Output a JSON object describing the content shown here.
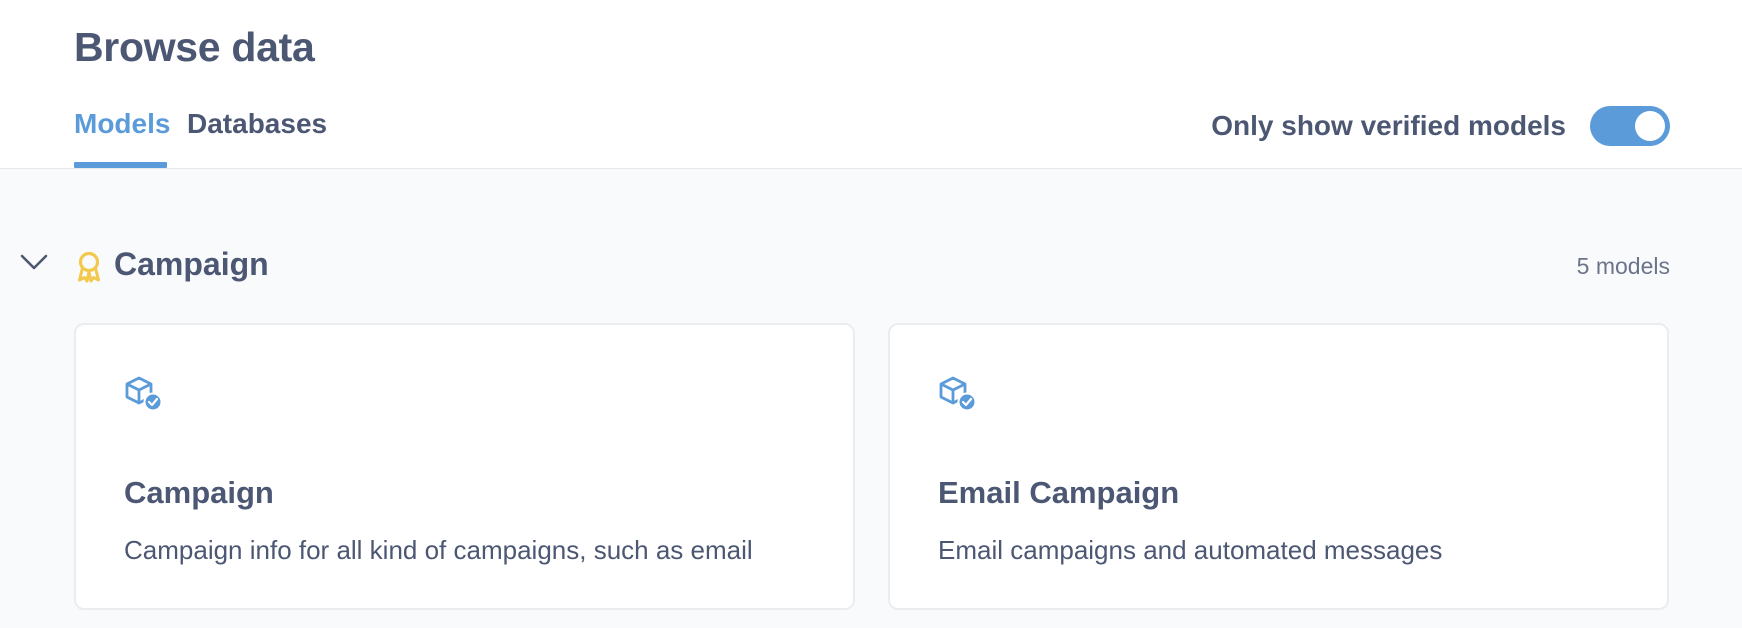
{
  "header": {
    "title": "Browse data",
    "tabs": [
      {
        "label": "Models",
        "active": true
      },
      {
        "label": "Databases",
        "active": false
      }
    ],
    "verified_toggle": {
      "label": "Only show verified models",
      "on": true
    }
  },
  "section": {
    "title": "Campaign",
    "count": "5 models",
    "expanded": true,
    "icon": "verified-badge-icon"
  },
  "cards": [
    {
      "icon": "verified-model-icon",
      "title": "Campaign",
      "description": "Campaign info for all kind of campaigns, such as email"
    },
    {
      "icon": "verified-model-icon",
      "title": "Email Campaign",
      "description": "Email campaigns and automated messages"
    }
  ],
  "colors": {
    "accent": "#5b9bd9",
    "text": "#4c5773",
    "badge": "#f2c94c",
    "background": "#f9fafb"
  }
}
